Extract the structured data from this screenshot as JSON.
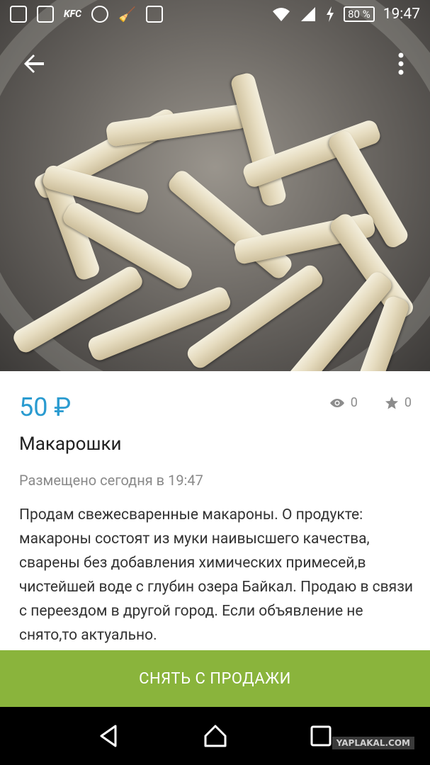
{
  "status_bar": {
    "kfc_label": "KFC",
    "battery": "80 %",
    "time": "19:47",
    "icons": [
      "screenshot-icon",
      "message-icon",
      "kfc-icon",
      "viber-icon",
      "broom-icon",
      "briefcase-check-icon",
      "wifi-icon",
      "signal-icon",
      "charging-icon",
      "battery-icon"
    ]
  },
  "app_bar": {
    "back_icon": "arrow-back-icon",
    "menu_icon": "more-vert-icon"
  },
  "listing": {
    "price": "50 ₽",
    "views": "0",
    "favorites": "0",
    "title": "Макарошки",
    "posted": "Размещено сегодня в 19:47",
    "description": "Продам свежесваренные макароны. О продукте: макароны состоят из муки наивысшего качества, сварены без добавления химических примесей,в чистейшей воде с глубин озера Байкал. Продаю в связи с переездом в другой город. Если объявление не снято,то актуально."
  },
  "action": {
    "label": "СНЯТЬ С ПРОДАЖИ",
    "color": "#8ab43c"
  },
  "nav": {
    "icons": [
      "back-triangle-icon",
      "home-icon",
      "recents-icon"
    ]
  },
  "watermark": "YAPLAKAL.COM",
  "colors": {
    "price": "#2a9bd0",
    "meta": "#8a8a8a"
  }
}
